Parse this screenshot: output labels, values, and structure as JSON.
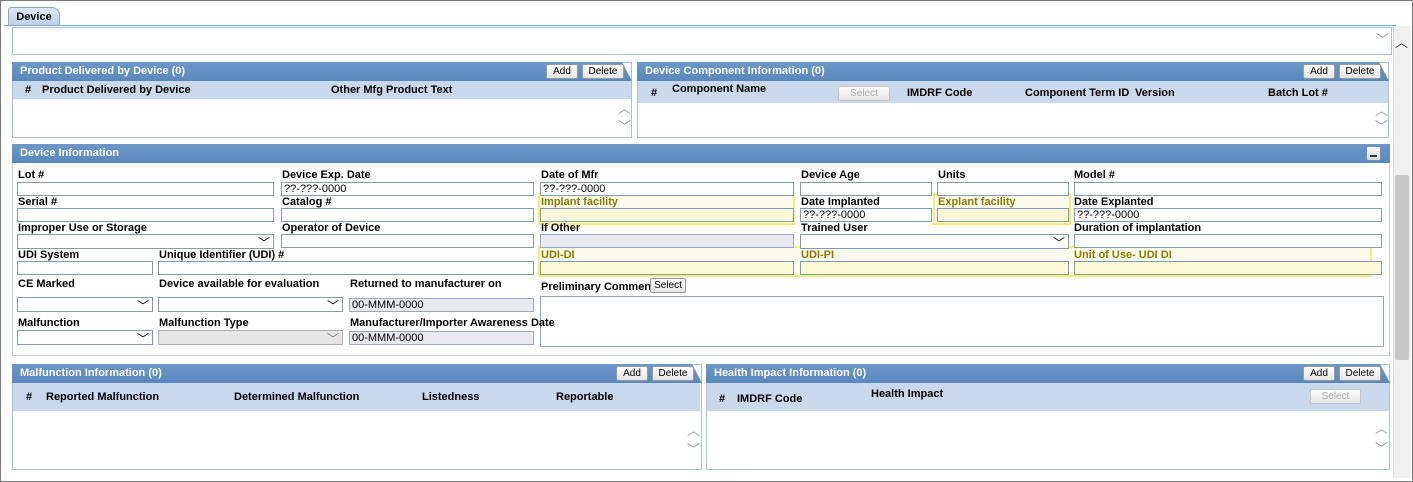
{
  "tab": {
    "label": "Device"
  },
  "product_delivered": {
    "title": "Product Delivered by Device (0)",
    "add": "Add",
    "delete": "Delete",
    "columns": [
      "#",
      "Product Delivered by Device",
      "Other Mfg Product Text"
    ]
  },
  "component_info": {
    "title": "Device Component Information (0)",
    "add": "Add",
    "delete": "Delete",
    "columns": [
      "#",
      "Component Name",
      "IMDRF Code",
      "Component Term ID",
      "Version",
      "Batch Lot #"
    ],
    "select": "Select"
  },
  "device_info": {
    "title": "Device Information",
    "fields": {
      "lot": {
        "label": "Lot #",
        "value": ""
      },
      "exp_date": {
        "label": "Device Exp. Date",
        "value": "??-???-0000"
      },
      "date_mfr": {
        "label": "Date of Mfr",
        "value": "??-???-0000"
      },
      "device_age": {
        "label": "Device Age",
        "value": ""
      },
      "units": {
        "label": "Units",
        "value": ""
      },
      "model": {
        "label": "Model #",
        "value": ""
      },
      "serial": {
        "label": "Serial #",
        "value": ""
      },
      "catalog": {
        "label": "Catalog #",
        "value": ""
      },
      "implant_facility": {
        "label": "Implant facility",
        "value": ""
      },
      "date_implanted": {
        "label": "Date Implanted",
        "value": "??-???-0000"
      },
      "explant_facility": {
        "label": "Explant facility",
        "value": ""
      },
      "date_explanted": {
        "label": "Date Explanted",
        "value": "??-???-0000"
      },
      "improper_use": {
        "label": "Improper Use or Storage",
        "value": ""
      },
      "operator": {
        "label": "Operator of Device",
        "value": ""
      },
      "if_other": {
        "label": "If Other",
        "value": ""
      },
      "trained_user": {
        "label": "Trained User",
        "value": ""
      },
      "duration": {
        "label": "Duration of implantation",
        "value": ""
      },
      "udi_system": {
        "label": "UDI System",
        "value": ""
      },
      "udi": {
        "label": "Unique Identifier (UDI) #",
        "value": ""
      },
      "udi_di": {
        "label": "UDI-DI",
        "value": ""
      },
      "udi_pi": {
        "label": "UDI-PI",
        "value": ""
      },
      "unit_of_use": {
        "label": "Unit of Use- UDI DI",
        "value": ""
      },
      "ce_marked": {
        "label": "CE Marked",
        "value": ""
      },
      "available_eval": {
        "label": "Device available for evaluation",
        "value": ""
      },
      "returned_mfr": {
        "label": "Returned to manufacturer on",
        "value": "00-MMM-0000"
      },
      "prelim_comments": {
        "label": "Preliminary Comments",
        "select": "Select",
        "value": ""
      },
      "malfunction": {
        "label": "Malfunction",
        "value": ""
      },
      "malfunction_type": {
        "label": "Malfunction Type",
        "value": ""
      },
      "awareness_date": {
        "label": "Manufacturer/Importer Awareness Date",
        "value": "00-MMM-0000"
      }
    }
  },
  "malfunction_info": {
    "title": "Malfunction Information (0)",
    "add": "Add",
    "delete": "Delete",
    "columns": [
      "#",
      "Reported Malfunction",
      "Determined Malfunction",
      "Listedness",
      "Reportable"
    ]
  },
  "health_impact": {
    "title": "Health Impact Information (0)",
    "add": "Add",
    "delete": "Delete",
    "columns": [
      "#",
      "IMDRF Code",
      "Health Impact"
    ],
    "select": "Select"
  }
}
